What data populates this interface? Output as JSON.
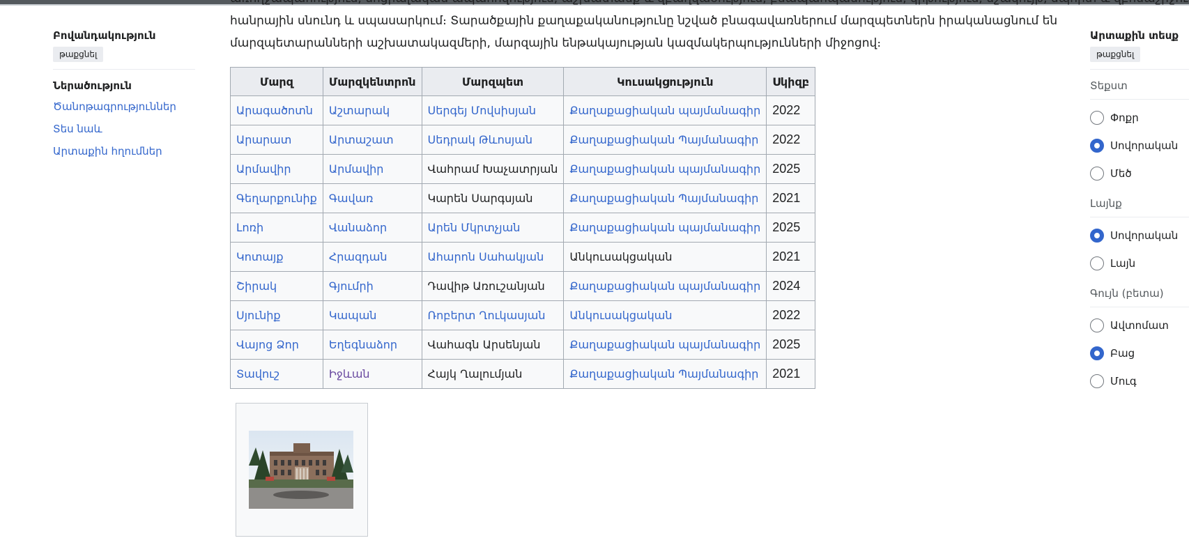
{
  "toc": {
    "title": "Բովանդակություն",
    "hide_label": "թաքցնել",
    "items": [
      {
        "label": "Ներածություն",
        "current": true
      },
      {
        "label": "Ծանոթագրություններ",
        "current": false
      },
      {
        "label": "Տես նաև",
        "current": false
      },
      {
        "label": "Արտաքին հղումներ",
        "current": false
      }
    ]
  },
  "article": {
    "para_lines": [
      "առողջապահություն, սոցիալական ապահովություն, աշխատանք և զբաղվածություն, բնապահպանություն, կրթություն, մշակույթ, սպորտ և զբոսաշրջություն",
      "հանրային սնունդ և սպասարկում։ Տարածքային քաղաքականությունը նշված բնագավառներում մարզպետներն իրականացնում են",
      "մարզպետարանների աշխատակազմերի, մարզային ենթակայության կազմակերպությունների միջոցով։"
    ],
    "table": {
      "headers": [
        "Մարզ",
        "Մարզկենտրոն",
        "Մարզպետ",
        "Կուսակցություն",
        "Սկիզբ"
      ],
      "rows": [
        [
          "Արագածոտն",
          "Աշտարակ",
          "Սերգեյ Մովսիսյան",
          "Քաղաքացիական պայմանագիր",
          "2022"
        ],
        [
          "Արարատ",
          "Արտաշատ",
          "Սեդրակ Թևոսյան",
          "Քաղաքացիական Պայմանագիր",
          "2022"
        ],
        [
          "Արմավիր",
          "Արմավիր",
          "Վահրամ Խաչատրյան",
          "Քաղաքացիական պայմանագիր",
          "2025"
        ],
        [
          "Գեղարքունիք",
          "Գավառ",
          "Կարեն Սարգսյան",
          "Քաղաքացիական Պայմանագիր",
          "2021"
        ],
        [
          "Լոռի",
          "Վանաձոր",
          "Արեն Մկրտչյան",
          "Քաղաքացիական պայմանագիր",
          "2025"
        ],
        [
          "Կոտայք",
          "Հրազդան",
          "Ահարոն Սահակյան",
          "Անկուսակցական",
          "2021"
        ],
        [
          "Շիրակ",
          "Գյումրի",
          "Դավիթ Առուշանյան",
          "Քաղաքացիական պայմանագիր",
          "2024"
        ],
        [
          "Սյունիք",
          "Կապան",
          "Ռոբերտ Ղուկասյան",
          "Անկուսակցական",
          "2022"
        ],
        [
          "Վայոց Ձոր",
          "Եղեգնաձոր",
          "Վահագն Արսենյան",
          "Քաղաքացիական պայմանագիր",
          "2025"
        ],
        [
          "Տավուշ",
          "Իջևան",
          "Հայկ Ղալումյան",
          "Քաղաքացիական Պայմանագիր",
          "2021"
        ]
      ],
      "cell_styles": [
        [
          "link",
          "link",
          "link",
          "link",
          "plain"
        ],
        [
          "link",
          "link",
          "link",
          "link",
          "plain"
        ],
        [
          "link",
          "link",
          "plain",
          "link",
          "plain"
        ],
        [
          "link",
          "link",
          "plain",
          "link",
          "plain"
        ],
        [
          "link",
          "link",
          "link",
          "link",
          "plain"
        ],
        [
          "link",
          "link",
          "link",
          "plain",
          "plain"
        ],
        [
          "link",
          "link",
          "plain",
          "link",
          "plain"
        ],
        [
          "link",
          "link",
          "link",
          "link",
          "plain"
        ],
        [
          "link",
          "link",
          "plain",
          "link",
          "plain"
        ],
        [
          "link",
          "visited",
          "plain",
          "link",
          "plain"
        ]
      ]
    }
  },
  "appearance": {
    "title": "Արտաքին տեսք",
    "hide_label": "թաքցնել",
    "groups": [
      {
        "heading": "Տեքստ",
        "options": [
          {
            "label": "Փոքր",
            "selected": false
          },
          {
            "label": "Սովորական",
            "selected": true
          },
          {
            "label": "Մեծ",
            "selected": false
          }
        ]
      },
      {
        "heading": "Լայնք",
        "options": [
          {
            "label": "Սովորական",
            "selected": true
          },
          {
            "label": "Լայն",
            "selected": false
          }
        ]
      },
      {
        "heading": "Գույն (բետա)",
        "options": [
          {
            "label": "Ավտոմատ",
            "selected": false
          },
          {
            "label": "Բաց",
            "selected": true
          },
          {
            "label": "Մուգ",
            "selected": false
          }
        ]
      }
    ]
  },
  "colors": {
    "link": "#3366cc",
    "visited": "#6b4ba1",
    "accent": "#3366cc"
  }
}
